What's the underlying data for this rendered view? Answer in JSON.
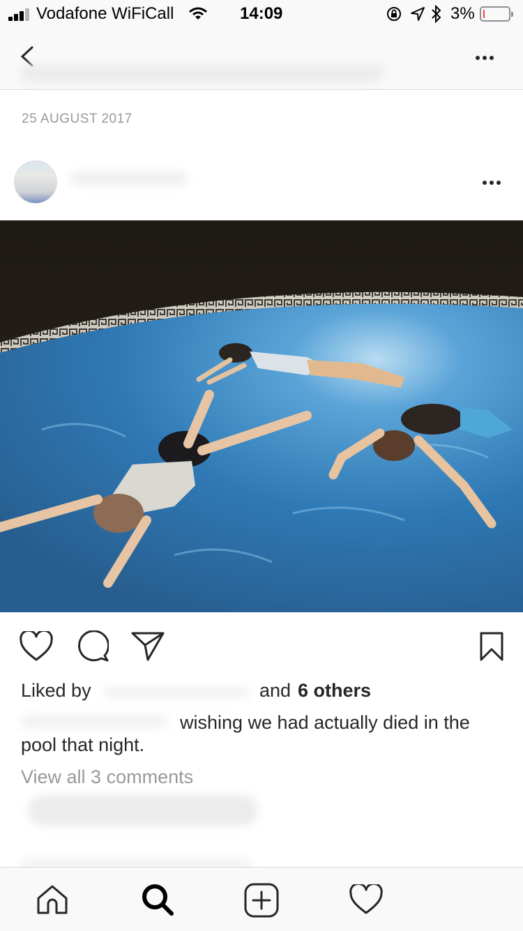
{
  "status_bar": {
    "carrier": "Vodafone WiFiCall",
    "time": "14:09",
    "battery_percent": "3%",
    "battery_level": 0.03,
    "icons": [
      "cellular-signal-icon",
      "wifi-icon",
      "orientation-lock-icon",
      "location-arrow-icon",
      "bluetooth-icon",
      "battery-icon"
    ]
  },
  "nav": {
    "back_icon": "chevron-left-icon",
    "more_icon": "more-horizontal-icon"
  },
  "post": {
    "date": "25 AUGUST 2017",
    "liked_by_prefix": "Liked by",
    "liked_by_suffix_word": "and",
    "liked_by_others": "6 others",
    "caption": "wishing we had actually died in the",
    "caption_continued": "pool that night.",
    "view_comments": "View all 3 comments"
  },
  "actions": [
    "heart-icon",
    "comment-icon",
    "share-icon",
    "bookmark-icon"
  ],
  "tab_bar": [
    "home-icon",
    "search-icon",
    "add-post-icon",
    "activity-heart-icon"
  ]
}
